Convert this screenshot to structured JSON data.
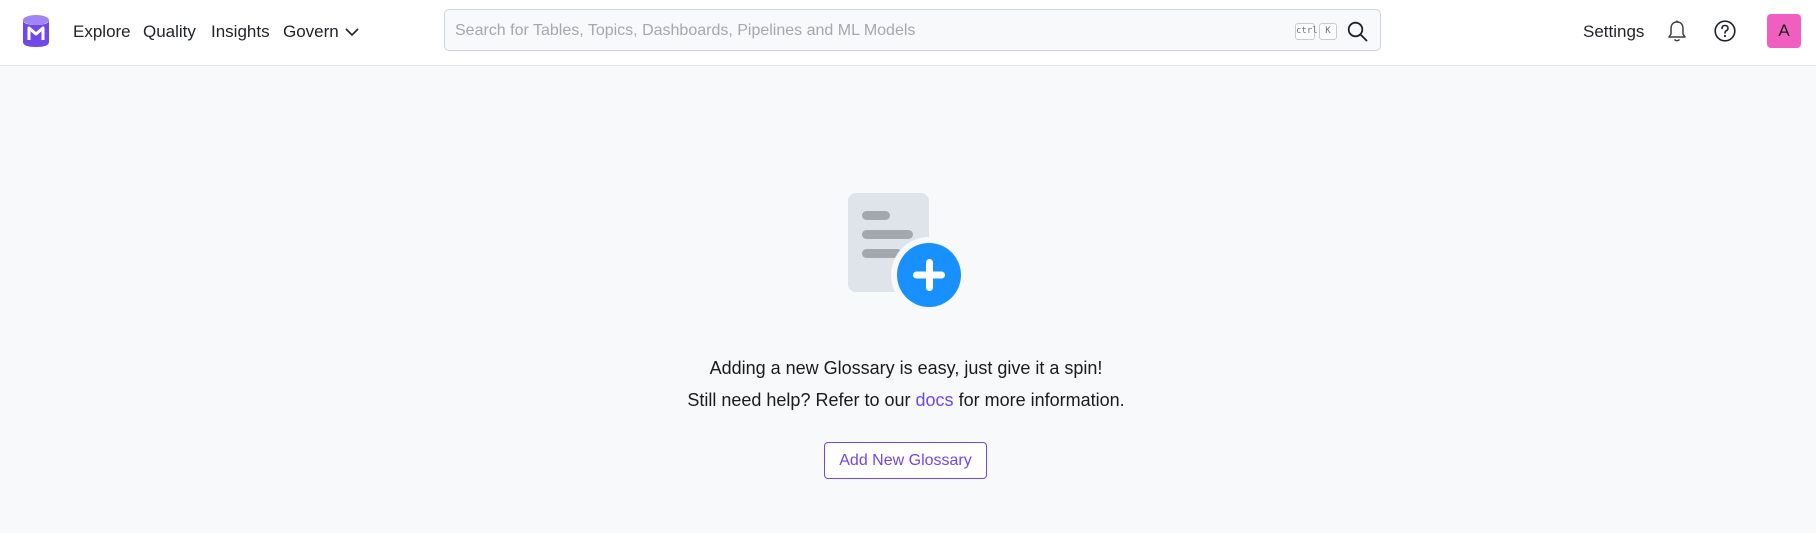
{
  "navbar": {
    "logo": "openmetadata-logo",
    "links": {
      "explore": "Explore",
      "quality": "Quality",
      "insights": "Insights",
      "govern": "Govern"
    },
    "search": {
      "placeholder": "Search for Tables, Topics, Dashboards, Pipelines and ML Models",
      "shortcut_ctrl": "ctrl",
      "shortcut_key": "K",
      "icon": "search-icon"
    },
    "settings": "Settings",
    "notifications_icon": "bell-icon",
    "help_icon": "help-circle-icon",
    "avatar_initial": "A"
  },
  "empty_state": {
    "illustration": "add-document-icon",
    "line1": "Adding a new Glossary is easy, just give it a spin!",
    "line2_before": "Still need help? Refer to our",
    "docs_link": "docs",
    "line2_after": "for more information.",
    "button": "Add New Glossary"
  },
  "colors": {
    "accent": "#7147e8",
    "plus_circle": "#1890ff",
    "avatar": "#f05fc0",
    "background": "#f8f9fa"
  }
}
